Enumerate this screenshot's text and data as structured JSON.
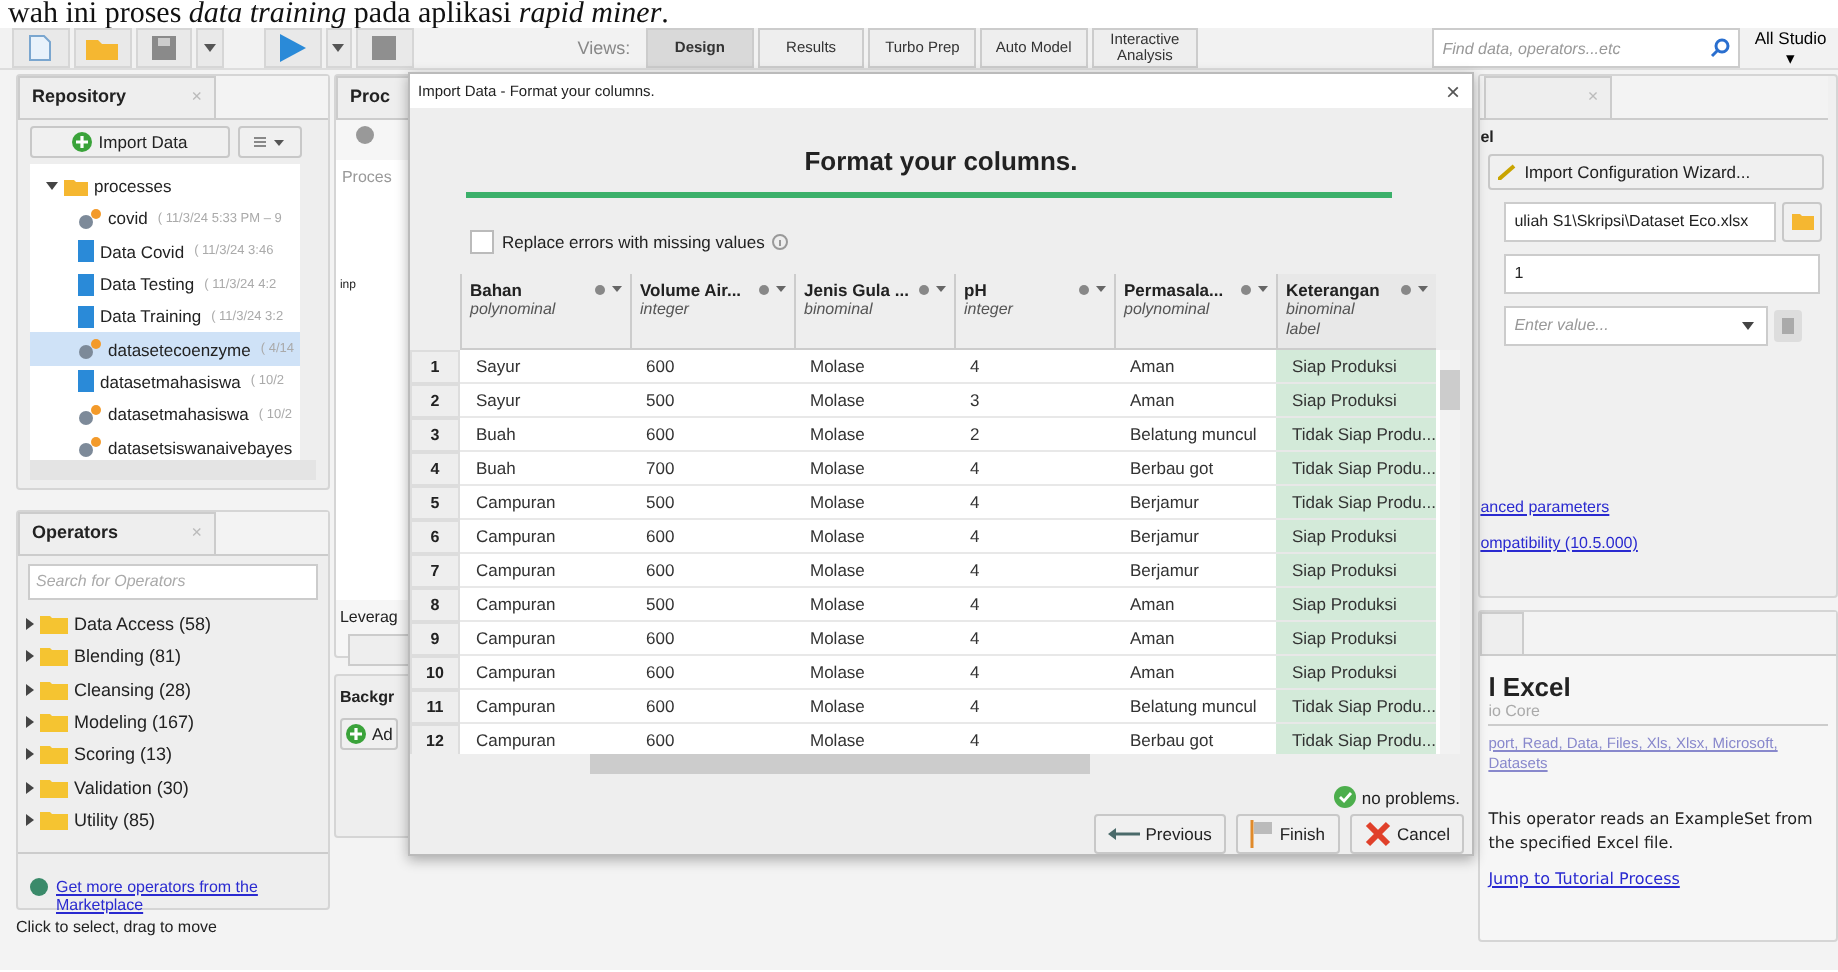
{
  "caption": "wah ini proses *data training* pada aplikasi *rapid miner*.",
  "toolbar": {
    "views_label": "Views:",
    "views": [
      {
        "label": "Design",
        "selected": true
      },
      {
        "label": "Results",
        "selected": false
      },
      {
        "label": "Turbo Prep",
        "selected": false
      },
      {
        "label": "Auto Model",
        "selected": false
      },
      {
        "label": "Interactive Analysis",
        "selected": false
      }
    ],
    "search_placeholder": "Find data, operators...etc",
    "studio": "All Studio ▾"
  },
  "repository": {
    "tab": "Repository",
    "close": "×",
    "import_button": "Import Data",
    "folder": {
      "name": "processes",
      "expanded": true,
      "children": [
        {
          "name": "covid",
          "meta": "( 11/3/24 5:33 PM – 9",
          "kind": "process",
          "selected": false
        },
        {
          "name": "Data Covid",
          "meta": "( 11/3/24 3:46",
          "kind": "data",
          "selected": false
        },
        {
          "name": "Data Testing",
          "meta": "( 11/3/24 4:2",
          "kind": "data",
          "selected": false
        },
        {
          "name": "Data Training",
          "meta": "( 11/3/24 3:2",
          "kind": "data",
          "selected": false
        },
        {
          "name": "datasetecoenzyme",
          "meta": "( 4/14",
          "kind": "process",
          "selected": true
        },
        {
          "name": "datasetmahasiswa",
          "meta": "( 10/2",
          "kind": "data",
          "selected": false
        },
        {
          "name": "datasetmahasiswa",
          "meta": "( 10/2",
          "kind": "process",
          "selected": false
        },
        {
          "name": "datasetsiswanaivebayes",
          "kind": "process",
          "selected": false
        }
      ]
    }
  },
  "operators": {
    "tab": "Operators",
    "close": "×",
    "search_placeholder": "Search for Operators",
    "groups": [
      "Data Access (58)",
      "Blending (81)",
      "Cleansing (28)",
      "Modeling (167)",
      "Scoring (13)",
      "Validation (30)",
      "Utility (85)"
    ],
    "marketplace_link": "Get more operators from the Marketplace"
  },
  "process_panel": {
    "tab": "Proc",
    "header": "Proces",
    "port": "inp",
    "leverage": "Leverag",
    "background": "Backgr",
    "add_button": "Ad"
  },
  "status_bar": "Click to select, drag to move",
  "dialog": {
    "title": "Import Data - Format your columns.",
    "close": "×",
    "heading": "Format your columns.",
    "replace_errors": {
      "label": "Replace errors with missing values",
      "checked": false
    },
    "columns": [
      {
        "name": "Bahan",
        "type": "polynominal",
        "label_column": false
      },
      {
        "name": "Volume Air...",
        "type": "integer",
        "label_column": false
      },
      {
        "name": "Jenis Gula ...",
        "type": "binominal",
        "label_column": false
      },
      {
        "name": "pH",
        "type": "integer",
        "label_column": false
      },
      {
        "name": "Permasala...",
        "type": "polynominal",
        "label_column": false
      },
      {
        "name": "Keterangan",
        "type": "binominal",
        "role": "label",
        "label_column": true
      }
    ],
    "rows": [
      {
        "number": "1",
        "cells": [
          "Sayur",
          "600",
          "Molase",
          "4",
          "Aman",
          "Siap Produksi"
        ]
      },
      {
        "number": "2",
        "cells": [
          "Sayur",
          "500",
          "Molase",
          "3",
          "Aman",
          "Siap Produksi"
        ]
      },
      {
        "number": "3",
        "cells": [
          "Buah",
          "600",
          "Molase",
          "2",
          "Belatung muncul",
          "Tidak Siap Produ..."
        ]
      },
      {
        "number": "4",
        "cells": [
          "Buah",
          "700",
          "Molase",
          "4",
          "Berbau got",
          "Tidak Siap Produ..."
        ]
      },
      {
        "number": "5",
        "cells": [
          "Campuran",
          "500",
          "Molase",
          "4",
          "Berjamur",
          "Tidak Siap Produ..."
        ]
      },
      {
        "number": "6",
        "cells": [
          "Campuran",
          "600",
          "Molase",
          "4",
          "Berjamur",
          "Siap Produksi"
        ]
      },
      {
        "number": "7",
        "cells": [
          "Campuran",
          "600",
          "Molase",
          "4",
          "Berjamur",
          "Siap Produksi"
        ]
      },
      {
        "number": "8",
        "cells": [
          "Campuran",
          "500",
          "Molase",
          "4",
          "Aman",
          "Siap Produksi"
        ]
      },
      {
        "number": "9",
        "cells": [
          "Campuran",
          "600",
          "Molase",
          "4",
          "Aman",
          "Siap Produksi"
        ]
      },
      {
        "number": "10",
        "cells": [
          "Campuran",
          "600",
          "Molase",
          "4",
          "Aman",
          "Siap Produksi"
        ]
      },
      {
        "number": "11",
        "cells": [
          "Campuran",
          "600",
          "Molase",
          "4",
          "Belatung muncul",
          "Tidak Siap Produ..."
        ]
      },
      {
        "number": "12",
        "cells": [
          "Campuran",
          "600",
          "Molase",
          "4",
          "Berbau got",
          "Tidak Siap Produ..."
        ]
      }
    ],
    "status": "no problems.",
    "buttons": {
      "previous": "Previous",
      "finish": "Finish",
      "cancel": "Cancel"
    }
  },
  "parameters": {
    "close": "×",
    "panel_label": "el",
    "wizard_button": "Import Configuration Wizard...",
    "file_value": "uliah S1\\Skripsi\\Dataset Eco.xlsx",
    "sheet_value": "1",
    "date_placeholder": "Enter value...",
    "links": [
      "anced parameters",
      "ompatibility (10.5.000)"
    ]
  },
  "help": {
    "title": "l Excel",
    "source": "io Core",
    "tags": "port, Read, Data, Files, Xls, Xlsx, Microsoft,",
    "tags2": "Datasets",
    "description": "This operator reads an ExampleSet from the specified Excel file.",
    "tutorial_link": "Jump to Tutorial Process"
  }
}
